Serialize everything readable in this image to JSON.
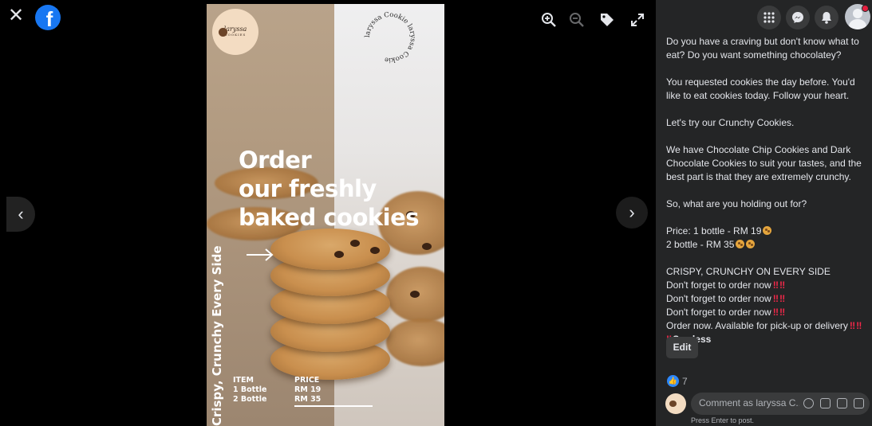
{
  "viewer": {
    "close_icon": "close-icon",
    "logo_icon": "facebook-logo-icon",
    "tools": [
      "zoom-in-icon",
      "zoom-out-icon",
      "tag-icon",
      "fullscreen-icon"
    ],
    "prev_icon": "chevron-left-icon",
    "next_icon": "chevron-right-icon"
  },
  "photo": {
    "brand_name": "laryssa",
    "brand_sub": "COOKIES",
    "circle_text": "laryssa Cookie  laryssa Cookie",
    "headline": [
      "Order",
      "our freshly",
      "baked cookies"
    ],
    "vertical_text": "Crispy, Crunchy Every Side",
    "item_header": "ITEM",
    "items": [
      "1 Bottle",
      "2 Bottle"
    ],
    "price_header": "PRICE",
    "prices": [
      "RM 19",
      "RM 35"
    ]
  },
  "panel": {
    "top_icons": [
      "menu-grid-icon",
      "messenger-icon",
      "notifications-icon"
    ],
    "post": {
      "p1": "Do you have a craving but don't know what to eat? Do you want something chocolatey?",
      "p2": "You requested cookies the day before. You'd like to eat cookies today. Follow your heart.",
      "p3": "Let's try our Crunchy Cookies.",
      "p4": "We have Chocolate Chip Cookies and Dark Chocolate Cookies to suit your tastes, and the best part is that they are extremely crunchy.",
      "p5": "So, what are you holding out for?",
      "price1": "Price: 1 bottle - RM 19",
      "price2": "2 bottle - RM 35",
      "crispy": "CRISPY, CRUNCHY ON EVERY SIDE",
      "dont_forget": "Don't forget to order now",
      "order_now": "Order now. Available for pick-up or delivery",
      "see_less": "See less"
    },
    "edit_label": "Edit",
    "like_count": "7",
    "comment_placeholder": "Comment as laryssa C...",
    "hint": "Press Enter to post.",
    "colors": {
      "panel_bg": "#242526",
      "accent": "#2d88ff",
      "alert": "#f02849"
    }
  }
}
